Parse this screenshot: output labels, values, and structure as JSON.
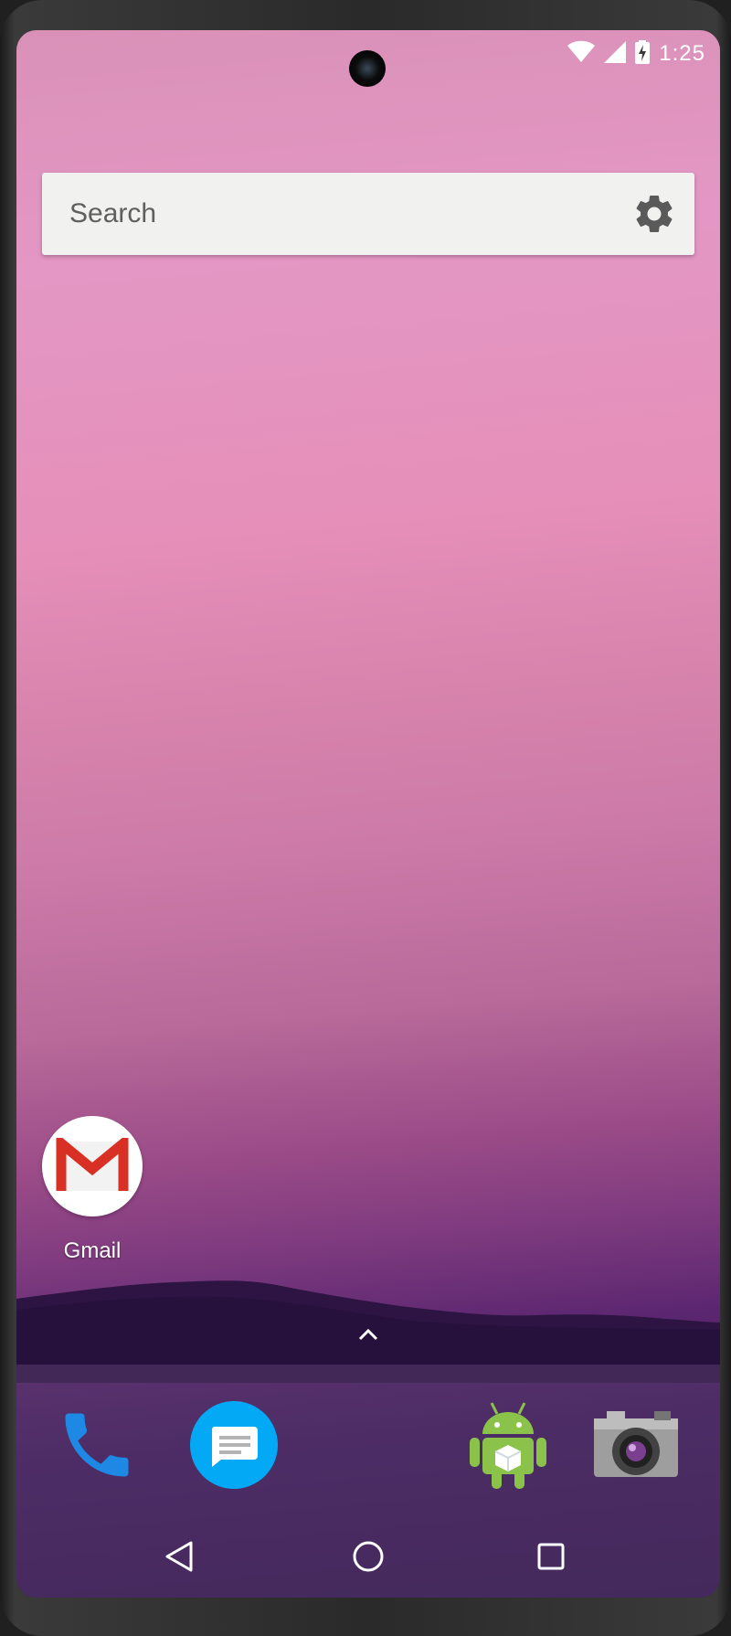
{
  "status_bar": {
    "time": "1:25",
    "icons": [
      "wifi-icon",
      "cell-signal-icon",
      "battery-charging-icon"
    ]
  },
  "search": {
    "placeholder": "Search",
    "icon": "gear-icon"
  },
  "home_apps": [
    {
      "label": "Gmail",
      "icon": "gmail-icon"
    }
  ],
  "dock": [
    {
      "icon": "phone-icon"
    },
    {
      "icon": "messages-icon"
    },
    {
      "icon": "android-app-icon"
    },
    {
      "icon": "camera-icon"
    }
  ],
  "nav": [
    "back-icon",
    "home-icon",
    "recents-icon"
  ],
  "colors": {
    "search_bg": "#f1f1f0",
    "phone_blue": "#1e88e5",
    "messages_blue": "#03a9f4",
    "android_green": "#8bc34a",
    "gmail_red": "#d93025"
  }
}
